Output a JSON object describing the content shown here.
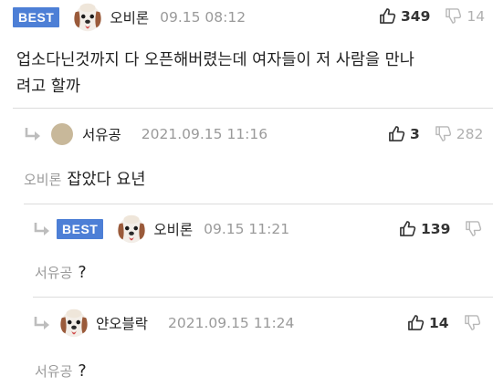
{
  "badge": {
    "best": "BEST"
  },
  "comments": [
    {
      "nickname": "오비론",
      "timestamp": "09.15 08:12",
      "likes": "349",
      "dislikes": "14",
      "body": [
        "업소다닌것까지 다 오픈해버렸는데 여자들이 저 사람을 만나",
        "려고 할까"
      ]
    },
    {
      "nickname": "서유공",
      "timestamp": "2021.09.15 11:16",
      "likes": "3",
      "dislikes": "282",
      "reply_to": "오비론",
      "body": "잡았다 요년"
    },
    {
      "nickname": "오비론",
      "timestamp": "09.15 11:21",
      "likes": "139",
      "dislikes": "",
      "reply_to": "서유공",
      "body": "?"
    },
    {
      "nickname": "얀오블락",
      "timestamp": "2021.09.15 11:24",
      "likes": "14",
      "dislikes": "",
      "reply_to": "서유공",
      "body": "?"
    }
  ]
}
